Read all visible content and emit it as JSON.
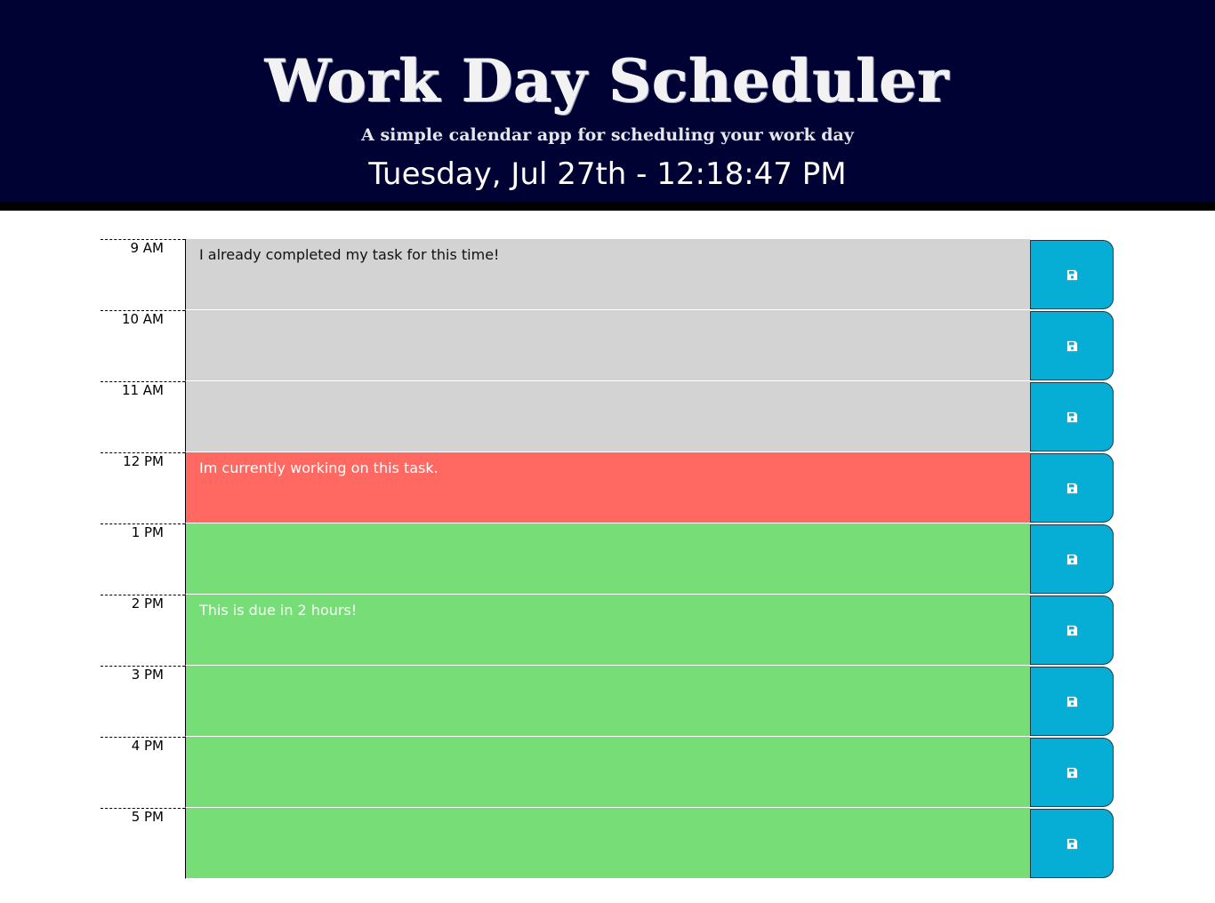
{
  "header": {
    "title": "Work Day Scheduler",
    "lead": "A simple calendar app for scheduling your work day",
    "current_day": "Tuesday, Jul 27th - 12:18:47 PM"
  },
  "colors": {
    "header_bg": "#000233",
    "past": "#d3d3d3",
    "present": "#ff6961",
    "future": "#77dd77",
    "save_button": "#06aed5"
  },
  "time_blocks": [
    {
      "hour": "9 AM",
      "text": "I already completed my task for this time!",
      "status": "past",
      "save_icon": "floppy-disk-icon"
    },
    {
      "hour": "10 AM",
      "text": "",
      "status": "past",
      "save_icon": "floppy-disk-icon"
    },
    {
      "hour": "11 AM",
      "text": "",
      "status": "past",
      "save_icon": "floppy-disk-icon"
    },
    {
      "hour": "12 PM",
      "text": "Im currently working on this task.",
      "status": "present",
      "save_icon": "floppy-disk-icon"
    },
    {
      "hour": "1 PM",
      "text": "",
      "status": "future",
      "save_icon": "floppy-disk-icon"
    },
    {
      "hour": "2 PM",
      "text": "This is due in 2 hours!",
      "status": "future",
      "save_icon": "floppy-disk-icon"
    },
    {
      "hour": "3 PM",
      "text": "",
      "status": "future",
      "save_icon": "floppy-disk-icon"
    },
    {
      "hour": "4 PM",
      "text": "",
      "status": "future",
      "save_icon": "floppy-disk-icon"
    },
    {
      "hour": "5 PM",
      "text": "",
      "status": "future",
      "save_icon": "floppy-disk-icon"
    }
  ]
}
